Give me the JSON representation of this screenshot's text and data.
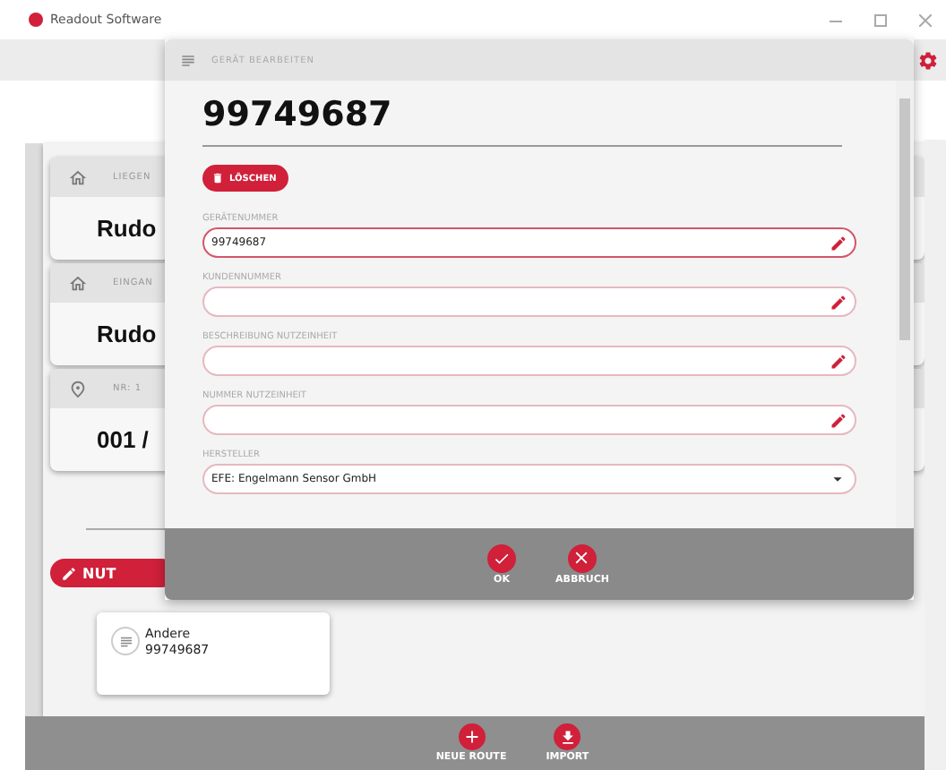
{
  "window": {
    "title": "Readout Software"
  },
  "background_cards": [
    {
      "header": "LIEGEN",
      "title": "Rudo"
    },
    {
      "header": "EINGAN",
      "title": "Rudo"
    },
    {
      "header": "NR: 1",
      "title": "001 /"
    }
  ],
  "edit_button": {
    "label": "NUT"
  },
  "device_tile": {
    "type": "Andere",
    "number": "99749687"
  },
  "bottom_actions": [
    {
      "label": "NEUE ROUTE"
    },
    {
      "label": "IMPORT"
    }
  ],
  "dialog": {
    "title": "GERÄT BEARBEITEN",
    "heading": "99749687",
    "delete_button": "LÖSCHEN",
    "fields": [
      {
        "kind": "text",
        "label": "GERÄTENUMMER",
        "value": "99749687"
      },
      {
        "kind": "text",
        "label": "KUNDENNUMMER"
      },
      {
        "kind": "text",
        "label": "BESCHREIBUNG NUTZEINHEIT"
      },
      {
        "kind": "text",
        "label": "NUMMER NUTZEINHEIT"
      },
      {
        "kind": "select",
        "label": "HERSTELLER",
        "value": "EFE: Engelmann Sensor GmbH"
      }
    ],
    "buttons": [
      {
        "label": "OK"
      },
      {
        "label": "ABBRUCH"
      }
    ]
  }
}
